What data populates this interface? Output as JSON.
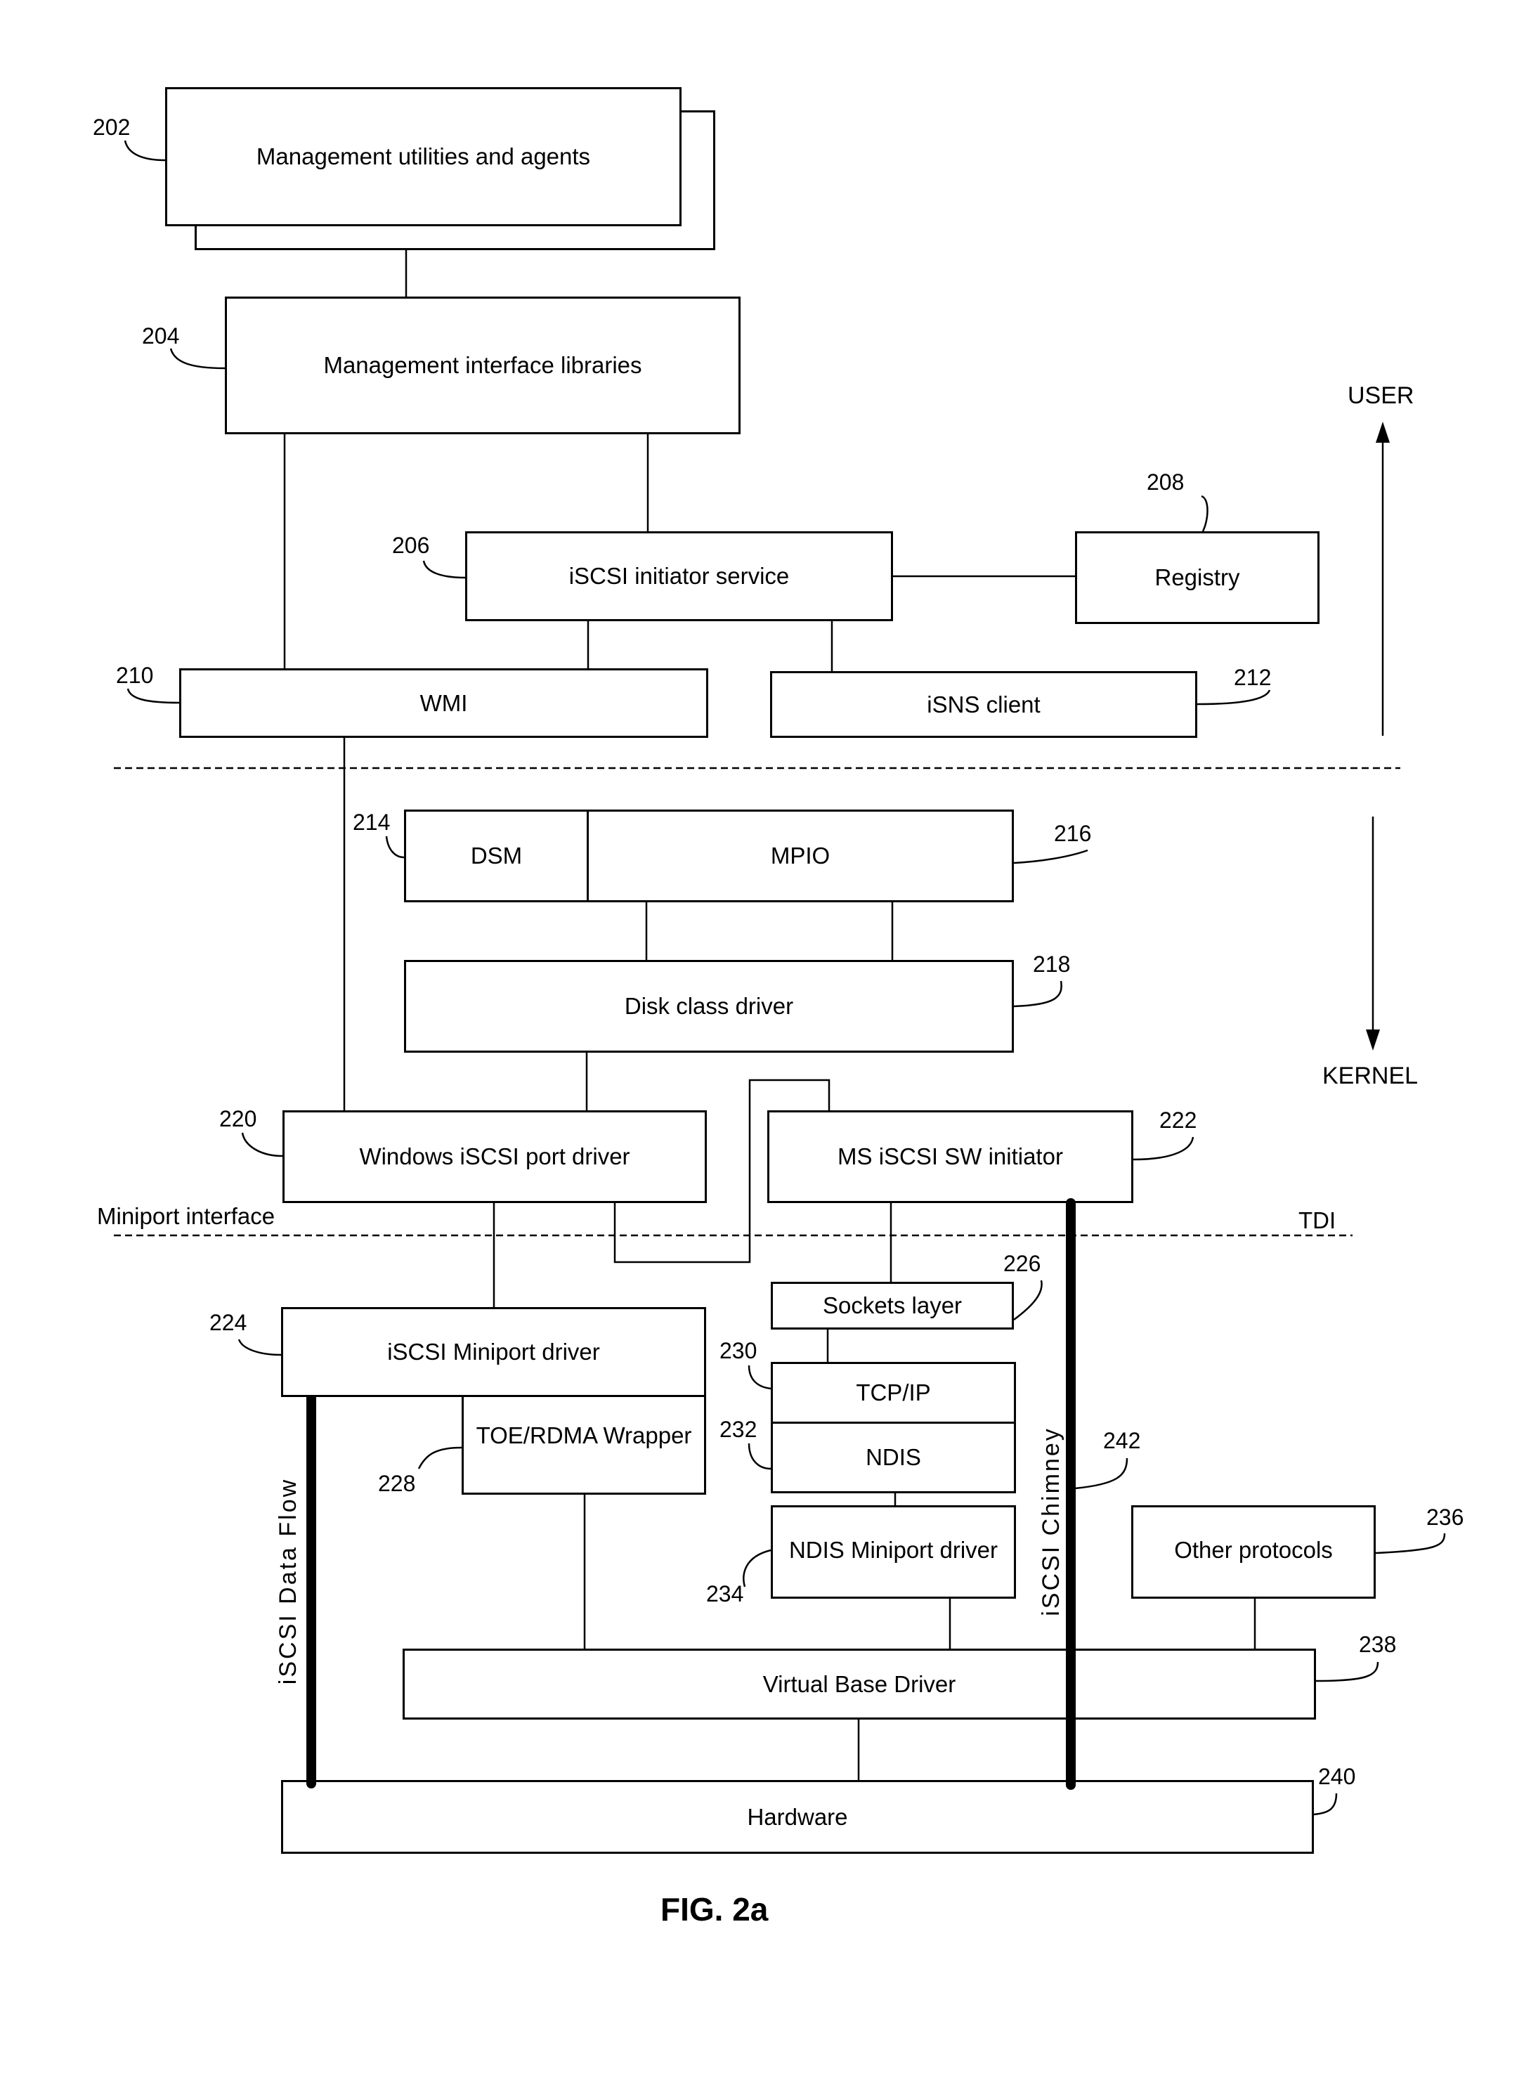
{
  "figure": {
    "caption": "FIG. 2a",
    "region_labels": {
      "user": "USER",
      "kernel": "KERNEL",
      "miniport_interface": "Miniport interface",
      "tdi": "TDI"
    },
    "components": {
      "mgmt_utilities": {
        "ref": "202",
        "label": "Management utilities and agents"
      },
      "mgmt_libraries": {
        "ref": "204",
        "label": "Management interface libraries"
      },
      "initiator_service": {
        "ref": "206",
        "label": "iSCSI initiator service"
      },
      "registry": {
        "ref": "208",
        "label": "Registry"
      },
      "wmi": {
        "ref": "210",
        "label": "WMI"
      },
      "isns_client": {
        "ref": "212",
        "label": "iSNS client"
      },
      "dsm": {
        "ref": "214",
        "label": "DSM"
      },
      "mpio": {
        "ref": "216",
        "label": "MPIO"
      },
      "disk_class": {
        "ref": "218",
        "label": "Disk class driver"
      },
      "port_driver": {
        "ref": "220",
        "label": "Windows iSCSI port driver"
      },
      "sw_initiator": {
        "ref": "222",
        "label": "MS iSCSI SW initiator"
      },
      "miniport_driver": {
        "ref": "224",
        "label": "iSCSI Miniport driver"
      },
      "sockets": {
        "ref": "226",
        "label": "Sockets layer"
      },
      "toe_wrapper": {
        "ref": "228",
        "label": "TOE/RDMA Wrapper"
      },
      "tcpip": {
        "ref": "230",
        "label": "TCP/IP"
      },
      "ndis": {
        "ref": "232",
        "label": "NDIS"
      },
      "ndis_miniport": {
        "ref": "234",
        "label": "NDIS Miniport driver"
      },
      "other_protocols": {
        "ref": "236",
        "label": "Other protocols"
      },
      "virtual_base": {
        "ref": "238",
        "label": "Virtual Base Driver"
      },
      "hardware": {
        "ref": "240",
        "label": "Hardware"
      }
    },
    "paths": {
      "data_flow": {
        "label": "iSCSI Data Flow"
      },
      "chimney": {
        "ref": "242",
        "label": "iSCSI Chimney"
      }
    }
  }
}
